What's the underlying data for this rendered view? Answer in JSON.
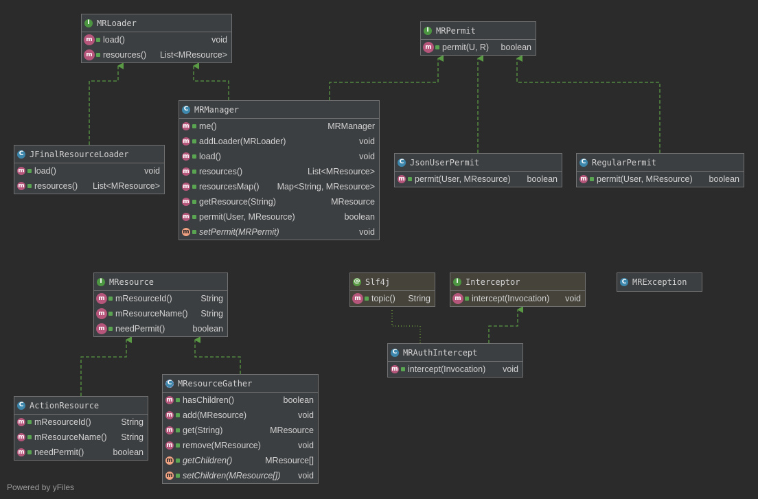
{
  "nodes": {
    "mrloader": {
      "kind": "interface",
      "title": "MRLoader",
      "methods": [
        {
          "name": "load()",
          "type": "void",
          "badge": "mlock"
        },
        {
          "name": "resources()",
          "type": "List<MResource>",
          "badge": "mlock"
        }
      ]
    },
    "mrpermit": {
      "kind": "interface",
      "title": "MRPermit",
      "methods": [
        {
          "name": "permit(U, R)",
          "type": "boolean",
          "badge": "mlock"
        }
      ]
    },
    "mrmanager": {
      "kind": "class",
      "title": "MRManager",
      "methods": [
        {
          "name": "me()",
          "type": "MRManager",
          "badge": "m"
        },
        {
          "name": "addLoader(MRLoader)",
          "type": "void",
          "badge": "m"
        },
        {
          "name": "load()",
          "type": "void",
          "badge": "m"
        },
        {
          "name": "resources()",
          "type": "List<MResource>",
          "badge": "m"
        },
        {
          "name": "resourcesMap()",
          "type": "Map<String, MResource>",
          "badge": "m"
        },
        {
          "name": "getResource(String)",
          "type": "MResource",
          "badge": "m"
        },
        {
          "name": "permit(User, MResource)",
          "type": "boolean",
          "badge": "m"
        },
        {
          "name": "setPermit(MRPermit)",
          "type": "void",
          "badge": "mabs",
          "italic": true
        }
      ]
    },
    "jfinal": {
      "kind": "class",
      "title": "JFinalResourceLoader",
      "methods": [
        {
          "name": "load()",
          "type": "void",
          "badge": "m"
        },
        {
          "name": "resources()",
          "type": "List<MResource>",
          "badge": "m"
        }
      ]
    },
    "jsonuser": {
      "kind": "class",
      "title": "JsonUserPermit",
      "methods": [
        {
          "name": "permit(User, MResource)",
          "type": "boolean",
          "badge": "m"
        }
      ]
    },
    "regular": {
      "kind": "class",
      "title": "RegularPermit",
      "methods": [
        {
          "name": "permit(User, MResource)",
          "type": "boolean",
          "badge": "m"
        }
      ]
    },
    "mresource": {
      "kind": "interface",
      "title": "MResource",
      "methods": [
        {
          "name": "mResourceId()",
          "type": "String",
          "badge": "mlock"
        },
        {
          "name": "mResourceName()",
          "type": "String",
          "badge": "mlock"
        },
        {
          "name": "needPermit()",
          "type": "boolean",
          "badge": "mlock"
        }
      ]
    },
    "slf4j": {
      "kind": "annotation",
      "title": "Slf4j",
      "methods": [
        {
          "name": "topic()",
          "type": "String",
          "badge": "mlock"
        }
      ]
    },
    "interceptor": {
      "kind": "interface",
      "title": "Interceptor",
      "methods": [
        {
          "name": "intercept(Invocation)",
          "type": "void",
          "badge": "mlock"
        }
      ]
    },
    "mrexception": {
      "kind": "class",
      "title": "MRException",
      "methods": []
    },
    "mrauth": {
      "kind": "class",
      "title": "MRAuthIntercept",
      "methods": [
        {
          "name": "intercept(Invocation)",
          "type": "void",
          "badge": "m"
        }
      ]
    },
    "actionres": {
      "kind": "class",
      "title": "ActionResource",
      "methods": [
        {
          "name": "mResourceId()",
          "type": "String",
          "badge": "m"
        },
        {
          "name": "mResourceName()",
          "type": "String",
          "badge": "m"
        },
        {
          "name": "needPermit()",
          "type": "boolean",
          "badge": "m"
        }
      ]
    },
    "gather": {
      "kind": "abstract",
      "title": "MResourceGather",
      "methods": [
        {
          "name": "hasChildren()",
          "type": "boolean",
          "badge": "m"
        },
        {
          "name": "add(MResource)",
          "type": "void",
          "badge": "m"
        },
        {
          "name": "get(String)",
          "type": "MResource",
          "badge": "m"
        },
        {
          "name": "remove(MResource)",
          "type": "void",
          "badge": "m"
        },
        {
          "name": "getChildren()",
          "type": "MResource[]",
          "badge": "mabs",
          "italic": true
        },
        {
          "name": "setChildren(MResource[])",
          "type": "void",
          "badge": "mabs",
          "italic": true
        }
      ]
    }
  },
  "badges": {
    "interface": "I",
    "class": "C",
    "abstract": "C",
    "annotation": "@",
    "m": "m",
    "mlock": "m",
    "mabs": "m"
  },
  "colors": {
    "background": "#2b2b2b",
    "node": "#3c3f41",
    "border": "#727272",
    "edge": "#5a9a45",
    "text": "#d2d2d2"
  },
  "footer": "Powered by yFiles"
}
